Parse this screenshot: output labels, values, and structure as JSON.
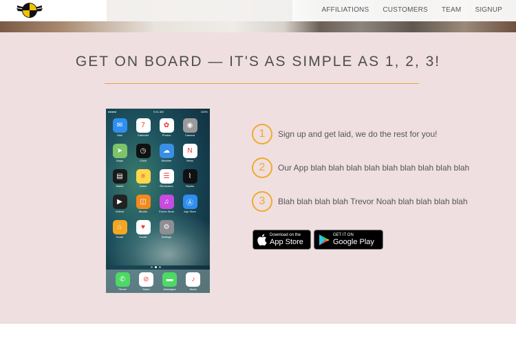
{
  "header": {
    "logo_icon": "wings-shield-logo",
    "nav": [
      {
        "label": "AFFILIATIONS"
      },
      {
        "label": "CUSTOMERS"
      },
      {
        "label": "TEAM"
      },
      {
        "label": "SIGNUP"
      }
    ]
  },
  "main": {
    "title": "GET ON BOARD — IT'S AS SIMPLE AS 1, 2, 3!",
    "accent_color": "#e5a24f",
    "steps": [
      {
        "number": "1",
        "text": "Sign up and get laid, we do the rest for you!"
      },
      {
        "number": "2",
        "text": "Our App blah blah blah blah blah blah blah blah blah"
      },
      {
        "number": "3",
        "text": "Blah blah blah blah Trevor Noah blah blah blah blah"
      }
    ],
    "badges": {
      "apple": {
        "small": "Download on the",
        "big": "App Store"
      },
      "google": {
        "small": "GET IT ON",
        "big": "Google Play"
      }
    }
  },
  "phone": {
    "status": {
      "carrier": "●●●●● ",
      "time": "9:41 AM",
      "battery": "100%"
    },
    "apps": [
      {
        "label": "Mail",
        "icon": "mail-icon",
        "color": "#2f8ef0",
        "glyph": "✉"
      },
      {
        "label": "Calendar",
        "icon": "calendar-icon",
        "color": "#ffffff",
        "glyph": "7"
      },
      {
        "label": "Photos",
        "icon": "photos-icon",
        "color": "#ffffff",
        "glyph": "✿"
      },
      {
        "label": "Camera",
        "icon": "camera-icon",
        "color": "#9a9a9a",
        "glyph": "◉"
      },
      {
        "label": "Maps",
        "icon": "maps-icon",
        "color": "#7cc36a",
        "glyph": "➤"
      },
      {
        "label": "Clock",
        "icon": "clock-icon",
        "color": "#111111",
        "glyph": "◷"
      },
      {
        "label": "Weather",
        "icon": "weather-icon",
        "color": "#3a8ee6",
        "glyph": "☁"
      },
      {
        "label": "News",
        "icon": "news-icon",
        "color": "#ffffff",
        "glyph": "N"
      },
      {
        "label": "Wallet",
        "icon": "wallet-icon",
        "color": "#1a1a1a",
        "glyph": "▤"
      },
      {
        "label": "Notes",
        "icon": "notes-icon",
        "color": "#ffd84a",
        "glyph": "≡"
      },
      {
        "label": "Reminders",
        "icon": "reminders-icon",
        "color": "#ffffff",
        "glyph": "☰"
      },
      {
        "label": "Stocks",
        "icon": "stocks-icon",
        "color": "#111111",
        "glyph": "⌇"
      },
      {
        "label": "Videos",
        "icon": "videos-icon",
        "color": "#222222",
        "glyph": "▶"
      },
      {
        "label": "iBooks",
        "icon": "ibooks-icon",
        "color": "#f28a1e",
        "glyph": "◫"
      },
      {
        "label": "iTunes Store",
        "icon": "itunes-store-icon",
        "color": "#c74be0",
        "glyph": "♫"
      },
      {
        "label": "App Store",
        "icon": "app-store-icon",
        "color": "#2f8ef0",
        "glyph": "Ⓐ"
      },
      {
        "label": "Home",
        "icon": "home-icon",
        "color": "#f5a623",
        "glyph": "⌂"
      },
      {
        "label": "Health",
        "icon": "health-icon",
        "color": "#ffffff",
        "glyph": "♥"
      },
      {
        "label": "Settings",
        "icon": "settings-icon",
        "color": "#8e8e93",
        "glyph": "⚙"
      }
    ],
    "dock": [
      {
        "label": "Phone",
        "icon": "phone-icon",
        "color": "#4cd964",
        "glyph": "✆"
      },
      {
        "label": "Safari",
        "icon": "safari-icon",
        "color": "#ffffff",
        "glyph": "⊘"
      },
      {
        "label": "Messages",
        "icon": "messages-icon",
        "color": "#4cd964",
        "glyph": "▬"
      },
      {
        "label": "Music",
        "icon": "music-icon",
        "color": "#ffffff",
        "glyph": "♪"
      }
    ]
  }
}
